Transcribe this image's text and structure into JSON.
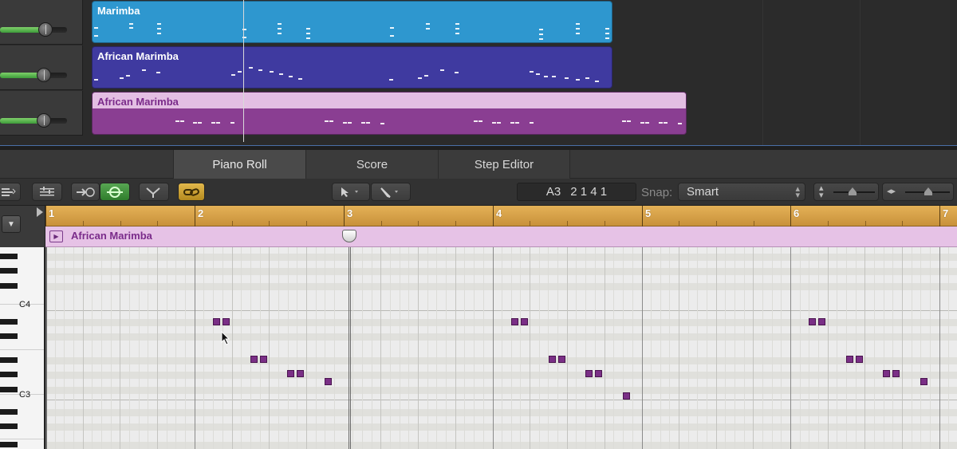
{
  "tracks": [
    {
      "name": "Marimba",
      "color": "#2e97cf",
      "header_color": "#2e97cf",
      "name_color": "#ffffff"
    },
    {
      "name": "African Marimba",
      "color": "#3f3aa0",
      "header_color": "#3f3aa0",
      "name_color": "#ffffff"
    },
    {
      "name": "African Marimba",
      "color": "#8a3e92",
      "header_color": "#e3bee3",
      "name_color": "#7a2b8a"
    }
  ],
  "tabs": {
    "piano_roll": "Piano Roll",
    "score": "Score",
    "step_editor": "Step Editor"
  },
  "toolbar": {
    "position_note": "A3",
    "position_value": "2 1 4 1",
    "snap_label": "Snap:",
    "snap_value": "Smart"
  },
  "ruler": {
    "bars": [
      "1",
      "2",
      "3",
      "4",
      "5",
      "6",
      "7"
    ]
  },
  "region": {
    "name": "African Marimba"
  },
  "keyboard": {
    "labels": [
      "C4",
      "C3"
    ]
  },
  "colors": {
    "note": "#7a2f86",
    "ruler": "#d9a04a",
    "region_strip": "#e6c2e6"
  }
}
